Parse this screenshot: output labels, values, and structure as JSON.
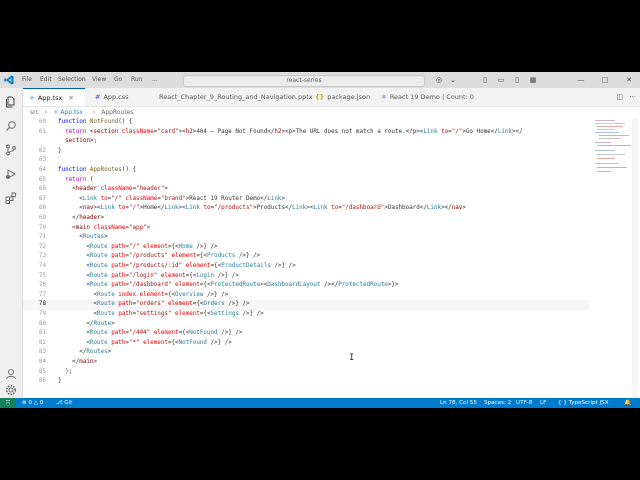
{
  "titlebar": {
    "menu": [
      "File",
      "Edit",
      "Selection",
      "View",
      "Go",
      "Run",
      "..."
    ],
    "search": "react-series",
    "controls": [
      "—",
      "□",
      "✕"
    ]
  },
  "tabs": [
    {
      "label": "App.tsx",
      "icon": "react-icon",
      "glyph": "⚛",
      "color": "#1f87c7",
      "active": true
    },
    {
      "label": "App.css",
      "icon": "css-icon",
      "glyph": "#",
      "color": "#6a5acd",
      "active": false
    },
    {
      "label": "React_Chapter_9_Routing_and_Navigation.pptx",
      "icon": "file-icon",
      "glyph": "▭",
      "color": "#888888",
      "active": false
    },
    {
      "label": "package.json",
      "icon": "json-icon",
      "glyph": "{}",
      "color": "#c9a400",
      "active": false
    },
    {
      "label": "React 19 Demo | Count: 0",
      "icon": "preview-icon",
      "glyph": "⚛",
      "color": "#7b3fbf",
      "active": false
    }
  ],
  "breadcrumb": [
    "src",
    "›",
    "App.tsx",
    "›",
    "AppRoutes"
  ],
  "editor": {
    "lines": [
      {
        "n": "60",
        "tokens": [
          [
            "kw2",
            "function "
          ],
          [
            "fn",
            "NotFound"
          ],
          [
            "pun",
            "() {"
          ]
        ]
      },
      {
        "n": "61",
        "tokens": [
          [
            "kw",
            "  return "
          ],
          [
            "pun",
            "<"
          ],
          [
            "tag",
            "section "
          ],
          [
            "attr",
            "className"
          ],
          [
            "pun",
            "="
          ],
          [
            "str",
            "\"card\""
          ],
          [
            "pun",
            "><"
          ],
          [
            "tag",
            "h2"
          ],
          [
            "pun",
            ">404 — Page Not Found</"
          ],
          [
            "tag",
            "h2"
          ],
          [
            "pun",
            "><"
          ],
          [
            "tag",
            "p"
          ],
          [
            "pun",
            ">The URL does not match a route.</"
          ],
          [
            "tag",
            "p"
          ],
          [
            "pun",
            "><"
          ],
          [
            "comp",
            "Link "
          ],
          [
            "attr",
            "to"
          ],
          [
            "pun",
            "="
          ],
          [
            "str",
            "\"/\""
          ],
          [
            "pun",
            ">Go Home</"
          ],
          [
            "comp",
            "Link"
          ],
          [
            "pun",
            "></"
          ]
        ]
      },
      {
        "n": "",
        "tokens": [
          [
            "tag",
            "  section"
          ],
          [
            "pun",
            ">;"
          ]
        ]
      },
      {
        "n": "62",
        "tokens": [
          [
            "pun",
            "}"
          ]
        ]
      },
      {
        "n": "63",
        "tokens": []
      },
      {
        "n": "64",
        "tokens": [
          [
            "kw2",
            "function "
          ],
          [
            "fn",
            "AppRoutes"
          ],
          [
            "pun",
            "() {"
          ]
        ]
      },
      {
        "n": "65",
        "tokens": [
          [
            "kw",
            "  return "
          ],
          [
            "pun",
            "("
          ]
        ]
      },
      {
        "n": "66",
        "tokens": [
          [
            "pun",
            "    <"
          ],
          [
            "tag",
            "header "
          ],
          [
            "attr",
            "className"
          ],
          [
            "pun",
            "="
          ],
          [
            "str",
            "\"header\""
          ],
          [
            "pun",
            ">"
          ]
        ]
      },
      {
        "n": "67",
        "tokens": [
          [
            "pun",
            "      <"
          ],
          [
            "comp",
            "Link "
          ],
          [
            "attr",
            "to"
          ],
          [
            "pun",
            "="
          ],
          [
            "str",
            "\"/\" "
          ],
          [
            "attr",
            "className"
          ],
          [
            "pun",
            "="
          ],
          [
            "str",
            "\"brand\""
          ],
          [
            "pun",
            ">React 19 Router Demo</"
          ],
          [
            "comp",
            "Link"
          ],
          [
            "pun",
            ">"
          ]
        ]
      },
      {
        "n": "68",
        "tokens": [
          [
            "pun",
            "      <"
          ],
          [
            "tag",
            "nav"
          ],
          [
            "pun",
            "><"
          ],
          [
            "comp",
            "Link "
          ],
          [
            "attr",
            "to"
          ],
          [
            "pun",
            "="
          ],
          [
            "str",
            "\"/\""
          ],
          [
            "pun",
            ">Home</"
          ],
          [
            "comp",
            "Link"
          ],
          [
            "pun",
            "><"
          ],
          [
            "comp",
            "Link "
          ],
          [
            "attr",
            "to"
          ],
          [
            "pun",
            "="
          ],
          [
            "str",
            "\"/products\""
          ],
          [
            "pun",
            ">Products</"
          ],
          [
            "comp",
            "Link"
          ],
          [
            "pun",
            "><"
          ],
          [
            "comp",
            "Link "
          ],
          [
            "attr",
            "to"
          ],
          [
            "pun",
            "="
          ],
          [
            "str",
            "\"/dashboard\""
          ],
          [
            "pun",
            ">Dashboard</"
          ],
          [
            "comp",
            "Link"
          ],
          [
            "pun",
            "></"
          ],
          [
            "tag",
            "nav"
          ],
          [
            "pun",
            ">"
          ]
        ]
      },
      {
        "n": "69",
        "tokens": [
          [
            "pun",
            "    </"
          ],
          [
            "tag",
            "header"
          ],
          [
            "pun",
            ">"
          ]
        ]
      },
      {
        "n": "70",
        "tokens": [
          [
            "pun",
            "    <"
          ],
          [
            "tag",
            "main "
          ],
          [
            "attr",
            "className"
          ],
          [
            "pun",
            "="
          ],
          [
            "str",
            "\"app\""
          ],
          [
            "pun",
            ">"
          ]
        ]
      },
      {
        "n": "71",
        "tokens": [
          [
            "pun",
            "      <"
          ],
          [
            "comp",
            "Routes"
          ],
          [
            "pun",
            ">"
          ]
        ]
      },
      {
        "n": "72",
        "tokens": [
          [
            "pun",
            "        <"
          ],
          [
            "comp",
            "Route "
          ],
          [
            "attr",
            "path"
          ],
          [
            "pun",
            "="
          ],
          [
            "str",
            "\"/\" "
          ],
          [
            "attr",
            "element"
          ],
          [
            "pun",
            "={<"
          ],
          [
            "comp",
            "Home "
          ],
          [
            "pun",
            "/>} />"
          ]
        ]
      },
      {
        "n": "73",
        "tokens": [
          [
            "pun",
            "        <"
          ],
          [
            "comp",
            "Route "
          ],
          [
            "attr",
            "path"
          ],
          [
            "pun",
            "="
          ],
          [
            "str",
            "\"/products\" "
          ],
          [
            "attr",
            "element"
          ],
          [
            "pun",
            "={<"
          ],
          [
            "comp",
            "Products "
          ],
          [
            "pun",
            "/>} />"
          ]
        ]
      },
      {
        "n": "74",
        "tokens": [
          [
            "pun",
            "        <"
          ],
          [
            "comp",
            "Route "
          ],
          [
            "attr",
            "path"
          ],
          [
            "pun",
            "="
          ],
          [
            "str",
            "\"/products/:id\" "
          ],
          [
            "attr",
            "element"
          ],
          [
            "pun",
            "={<"
          ],
          [
            "comp",
            "ProductDetails "
          ],
          [
            "pun",
            "/>} />"
          ]
        ]
      },
      {
        "n": "75",
        "tokens": [
          [
            "pun",
            "        <"
          ],
          [
            "comp",
            "Route "
          ],
          [
            "attr",
            "path"
          ],
          [
            "pun",
            "="
          ],
          [
            "str",
            "\"/login\" "
          ],
          [
            "attr",
            "element"
          ],
          [
            "pun",
            "={<"
          ],
          [
            "comp",
            "Login "
          ],
          [
            "pun",
            "/>} />"
          ]
        ]
      },
      {
        "n": "76",
        "tokens": [
          [
            "pun",
            "        <"
          ],
          [
            "comp",
            "Route "
          ],
          [
            "attr",
            "path"
          ],
          [
            "pun",
            "="
          ],
          [
            "str",
            "\"/dashboard\" "
          ],
          [
            "attr",
            "element"
          ],
          [
            "pun",
            "={<"
          ],
          [
            "comp",
            "ProtectedRoute"
          ],
          [
            "pun",
            "><"
          ],
          [
            "comp",
            "DashboardLayout "
          ],
          [
            "pun",
            "/></"
          ],
          [
            "comp",
            "ProtectedRoute"
          ],
          [
            "pun",
            ">}>"
          ]
        ]
      },
      {
        "n": "77",
        "tokens": [
          [
            "pun",
            "          <"
          ],
          [
            "comp",
            "Route "
          ],
          [
            "attr",
            "index "
          ],
          [
            "attr",
            "element"
          ],
          [
            "pun",
            "={<"
          ],
          [
            "comp",
            "Overview "
          ],
          [
            "pun",
            "/>} />"
          ]
        ]
      },
      {
        "n": "78",
        "current": true,
        "tokens": [
          [
            "pun",
            "          <"
          ],
          [
            "comp",
            "Route "
          ],
          [
            "attr",
            "path"
          ],
          [
            "pun",
            "="
          ],
          [
            "str",
            "\"orders\" "
          ],
          [
            "attr",
            "element"
          ],
          [
            "pun",
            "={<"
          ],
          [
            "comp",
            "Orders "
          ],
          [
            "pun",
            "/>} />"
          ]
        ]
      },
      {
        "n": "79",
        "tokens": [
          [
            "pun",
            "          <"
          ],
          [
            "comp",
            "Route "
          ],
          [
            "attr",
            "path"
          ],
          [
            "pun",
            "="
          ],
          [
            "str",
            "\"settings\" "
          ],
          [
            "attr",
            "element"
          ],
          [
            "pun",
            "={<"
          ],
          [
            "comp",
            "Settings "
          ],
          [
            "pun",
            "/>} />"
          ]
        ]
      },
      {
        "n": "80",
        "tokens": [
          [
            "pun",
            "        </"
          ],
          [
            "comp",
            "Route"
          ],
          [
            "pun",
            ">"
          ]
        ]
      },
      {
        "n": "81",
        "tokens": [
          [
            "pun",
            "        <"
          ],
          [
            "comp",
            "Route "
          ],
          [
            "attr",
            "path"
          ],
          [
            "pun",
            "="
          ],
          [
            "str",
            "\"/404\" "
          ],
          [
            "attr",
            "element"
          ],
          [
            "pun",
            "={<"
          ],
          [
            "comp",
            "NotFound "
          ],
          [
            "pun",
            "/>} />"
          ]
        ]
      },
      {
        "n": "82",
        "tokens": [
          [
            "pun",
            "        <"
          ],
          [
            "comp",
            "Route "
          ],
          [
            "attr",
            "path"
          ],
          [
            "pun",
            "="
          ],
          [
            "str",
            "\"*\" "
          ],
          [
            "attr",
            "element"
          ],
          [
            "pun",
            "={<"
          ],
          [
            "comp",
            "NotFound "
          ],
          [
            "pun",
            "/>} />"
          ]
        ]
      },
      {
        "n": "83",
        "tokens": [
          [
            "pun",
            "      </"
          ],
          [
            "comp",
            "Routes"
          ],
          [
            "pun",
            ">"
          ]
        ]
      },
      {
        "n": "84",
        "tokens": [
          [
            "pun",
            "    </"
          ],
          [
            "tag",
            "main"
          ],
          [
            "pun",
            ">"
          ]
        ]
      },
      {
        "n": "85",
        "tokens": [
          [
            "pun",
            "  );"
          ]
        ]
      },
      {
        "n": "86",
        "tokens": [
          [
            "pun",
            "}"
          ]
        ]
      }
    ]
  },
  "statusbar": {
    "problems": "⊗ 0 △ 0",
    "git": "Git",
    "position": "Ln 78, Col 55",
    "spaces": "Spaces: 2",
    "encoding": "UTF-8",
    "eol": "LF",
    "language": "TypeScript JSX"
  },
  "colors": {
    "accent": "#007acc",
    "remote": "#16825d"
  }
}
